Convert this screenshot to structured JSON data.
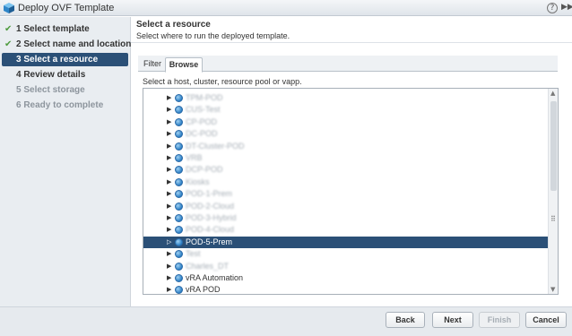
{
  "window": {
    "title": "Deploy OVF Template",
    "help_glyph": "?",
    "expand_glyph": "▶▶"
  },
  "nav": {
    "items": [
      {
        "label": "1  Select template",
        "state": "done"
      },
      {
        "label": "2  Select name and location",
        "state": "done"
      },
      {
        "label": "3  Select a resource",
        "state": "active"
      },
      {
        "label": "4  Review details",
        "state": "pending"
      },
      {
        "label": "5  Select storage",
        "state": "disabled"
      },
      {
        "label": "6  Ready to complete",
        "state": "disabled"
      }
    ],
    "check_glyph": "✔"
  },
  "main": {
    "title": "Select a resource",
    "subtitle": "Select where to run the deployed template.",
    "tabs": [
      {
        "label": "Filter"
      },
      {
        "label": "Browse",
        "active": true
      }
    ],
    "instruction": "Select a host, cluster, resource pool or vapp."
  },
  "tree": {
    "rows": [
      {
        "label": "TPM-POD",
        "blurred": true,
        "selected": false,
        "arrow": "▶"
      },
      {
        "label": "CUS-Test",
        "blurred": true,
        "selected": false,
        "arrow": "▶"
      },
      {
        "label": "CP-POD",
        "blurred": true,
        "selected": false,
        "arrow": "▶"
      },
      {
        "label": "DC-POD",
        "blurred": true,
        "selected": false,
        "arrow": "▶"
      },
      {
        "label": "DT-Cluster-POD",
        "blurred": true,
        "selected": false,
        "arrow": "▶"
      },
      {
        "label": "VRB",
        "blurred": true,
        "selected": false,
        "arrow": "▶"
      },
      {
        "label": "DCP-POD",
        "blurred": true,
        "selected": false,
        "arrow": "▶"
      },
      {
        "label": "Kiosks",
        "blurred": true,
        "selected": false,
        "arrow": "▶"
      },
      {
        "label": "POD-1-Prem",
        "blurred": true,
        "selected": false,
        "arrow": "▶"
      },
      {
        "label": "POD-2-Cloud",
        "blurred": true,
        "selected": false,
        "arrow": "▶"
      },
      {
        "label": "POD-3-Hybrid",
        "blurred": true,
        "selected": false,
        "arrow": "▶"
      },
      {
        "label": "POD-4-Cloud",
        "blurred": true,
        "selected": false,
        "arrow": "▶"
      },
      {
        "label": "POD-5-Prem",
        "blurred": false,
        "selected": true,
        "arrow": "▷"
      },
      {
        "label": "Test",
        "blurred": true,
        "selected": false,
        "arrow": "▶"
      },
      {
        "label": "Charles_DT",
        "blurred": true,
        "selected": false,
        "arrow": "▶"
      },
      {
        "label": "vRA Automation",
        "blurred": false,
        "selected": false,
        "arrow": "▶"
      },
      {
        "label": "vRA POD",
        "blurred": false,
        "selected": false,
        "arrow": "▶"
      }
    ],
    "scroll_up_glyph": "▲",
    "scroll_down_glyph": "▼",
    "grip_glyph": "⠿"
  },
  "footer": {
    "back": "Back",
    "next": "Next",
    "finish": "Finish",
    "cancel": "Cancel"
  }
}
